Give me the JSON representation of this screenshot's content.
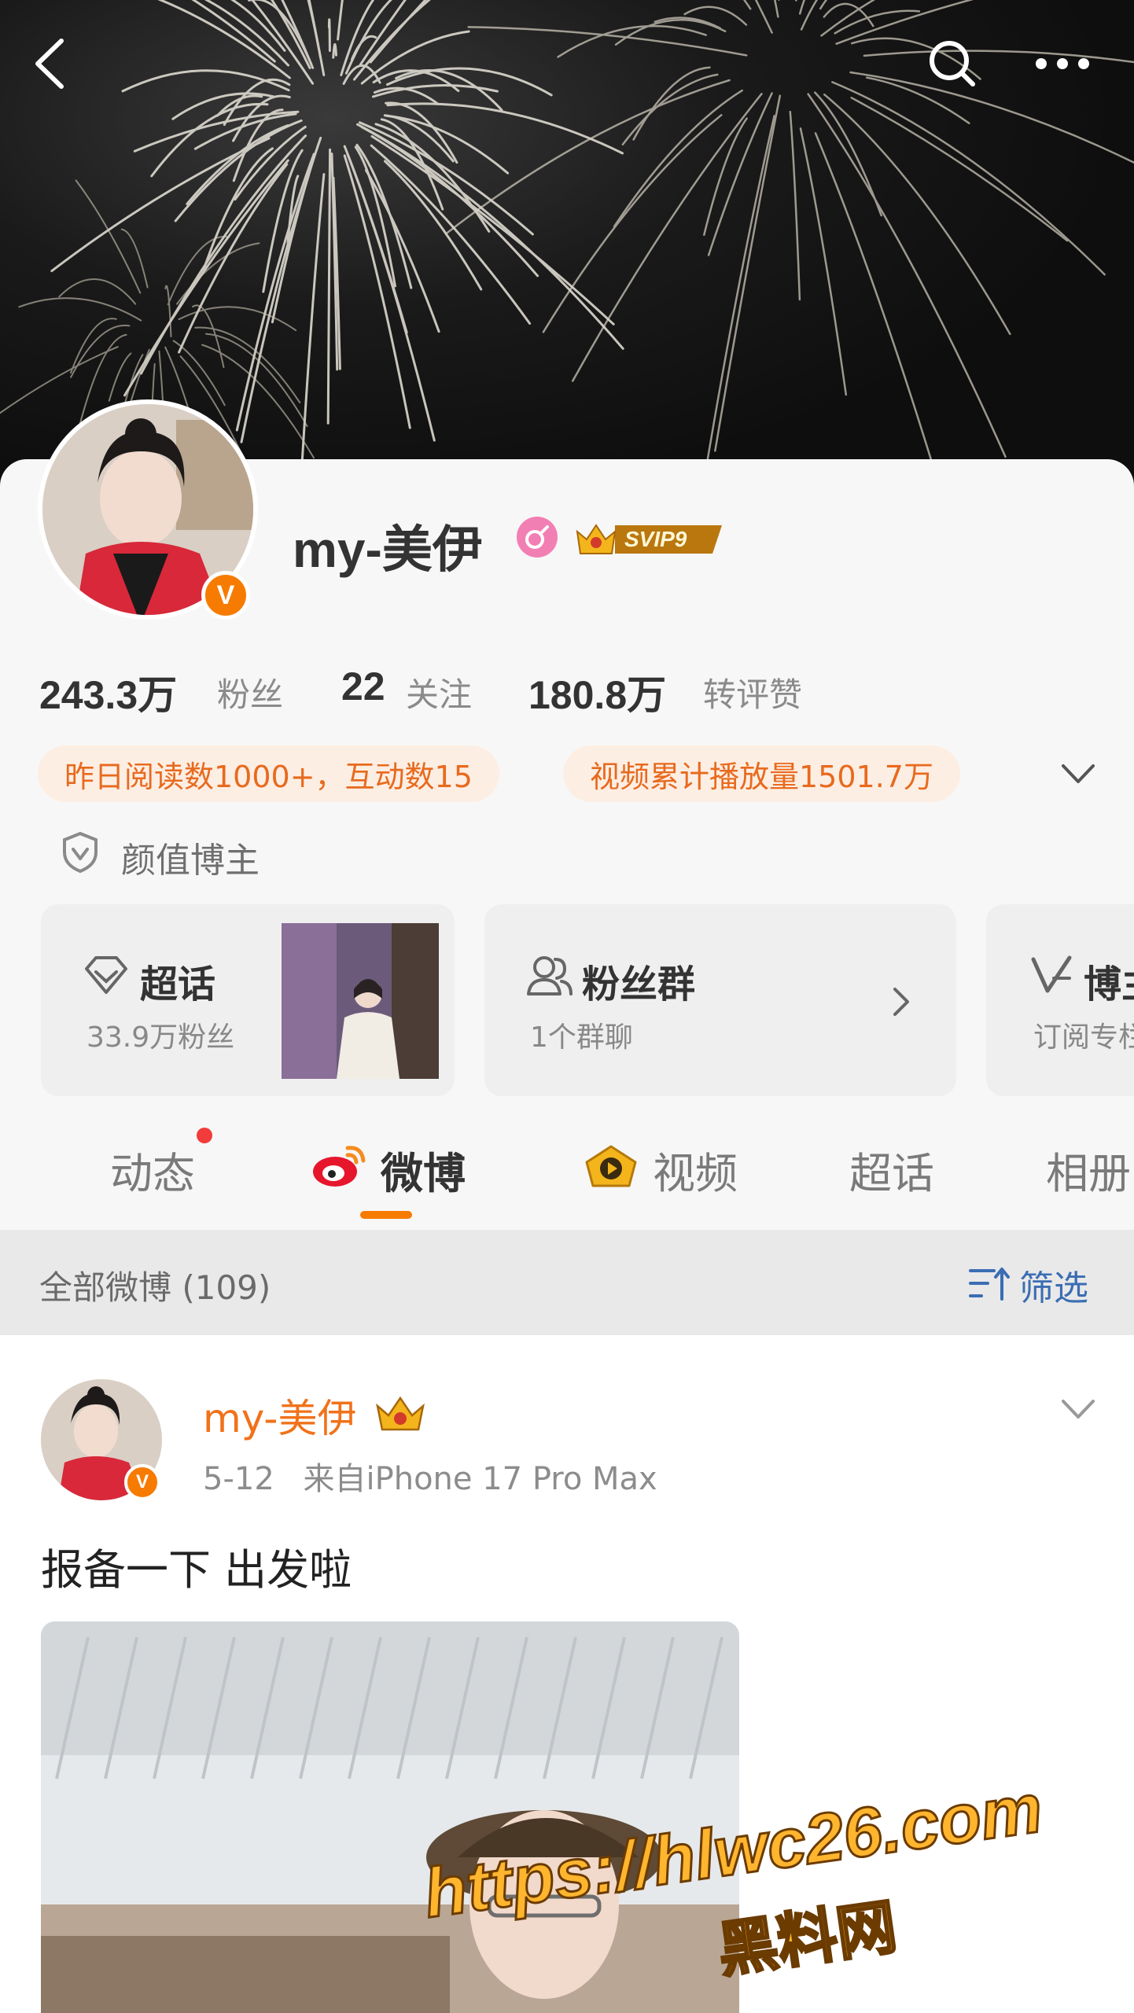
{
  "header": {
    "back_icon": "chevron-left-icon",
    "search_icon": "search-icon",
    "more_icon": "more-dots-icon"
  },
  "profile": {
    "name": "my-美伊",
    "gender_icon": "female-icon",
    "vip_badge": "SVIP9",
    "verified_mark": "V",
    "stats": [
      {
        "value": "243.3万",
        "label": "粉丝"
      },
      {
        "value": "22",
        "label": "关注"
      },
      {
        "value": "180.8万",
        "label": "转评赞"
      }
    ],
    "highlights": [
      "昨日阅读数1000+，互动数15",
      "视频累计播放量1501.7万"
    ],
    "tag": "颜值博主"
  },
  "quick_cards": [
    {
      "title": "超话",
      "subtitle": "33.9万粉丝"
    },
    {
      "title": "粉丝群",
      "subtitle": "1个群聊"
    },
    {
      "title": "博主",
      "subtitle": "订阅专栏"
    }
  ],
  "tabs": [
    {
      "label": "动态"
    },
    {
      "label": "微博"
    },
    {
      "label": "视频"
    },
    {
      "label": "超话"
    },
    {
      "label": "相册"
    }
  ],
  "feed_header": {
    "label": "全部微博 (109)",
    "filter_label": "筛选"
  },
  "post": {
    "author": "my-美伊",
    "date": "5-12",
    "source": "来自iPhone 17 Pro Max",
    "text": "报备一下 出发啦"
  },
  "watermark": {
    "url": "https://hlwc26.com",
    "site": "黑料网"
  },
  "colors": {
    "accent": "#f77b00",
    "highlight_bg": "#fdeee3",
    "highlight_text": "#e86a1e",
    "link_blue": "#3b6db3"
  }
}
